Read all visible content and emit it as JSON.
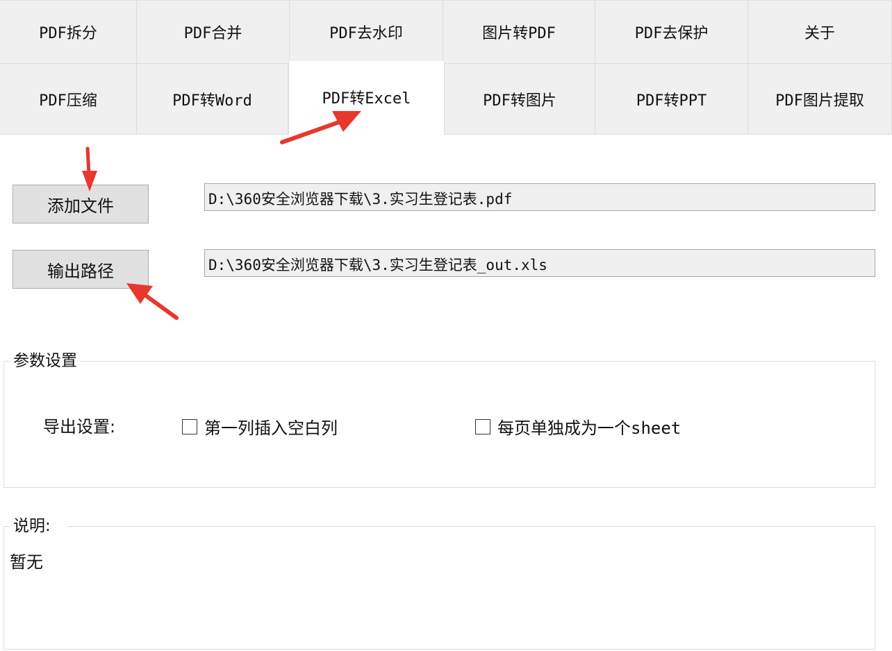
{
  "tabs": {
    "row1": [
      {
        "label": "PDF拆分"
      },
      {
        "label": "PDF合并"
      },
      {
        "label": "PDF去水印"
      },
      {
        "label": "图片转PDF"
      },
      {
        "label": "PDF去保护"
      },
      {
        "label": "关于"
      }
    ],
    "row2": [
      {
        "label": "PDF压缩"
      },
      {
        "label": "PDF转Word"
      },
      {
        "label": "PDF转Excel",
        "active": true
      },
      {
        "label": "PDF转图片"
      },
      {
        "label": "PDF转PPT"
      },
      {
        "label": "PDF图片提取"
      }
    ]
  },
  "file": {
    "add_button": "添加文件",
    "input_path": "D:\\360安全浏览器下载\\3.实习生登记表.pdf",
    "output_button": "输出路径",
    "output_path": "D:\\360安全浏览器下载\\3.实习生登记表_out.xls"
  },
  "params": {
    "title": "参数设置",
    "export_label": "导出设置:",
    "opt1": {
      "label": "第一列插入空白列",
      "checked": false
    },
    "opt2": {
      "label": "每页单独成为一个sheet",
      "checked": false
    }
  },
  "notes": {
    "title": "说明:",
    "text": "暂无"
  },
  "annotation_color": "#e8372c"
}
